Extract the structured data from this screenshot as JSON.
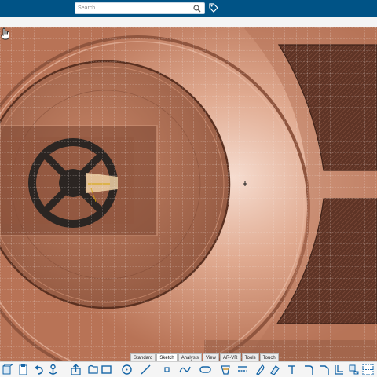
{
  "search": {
    "placeholder": "Search",
    "value": ""
  },
  "icons": {
    "search": "magnifier-icon",
    "tag": "tag-icon"
  },
  "tabs": [
    {
      "label": "Standard",
      "active": false
    },
    {
      "label": "Sketch",
      "active": true
    },
    {
      "label": "Analysis",
      "active": false
    },
    {
      "label": "View",
      "active": false
    },
    {
      "label": "AR-VR",
      "active": false
    },
    {
      "label": "Tools",
      "active": false
    },
    {
      "label": "Touch",
      "active": false
    }
  ],
  "colors": {
    "topbar": "#005386",
    "copper": "#c98c6e",
    "dark_copper": "#6b3e2c",
    "accent_blue": "#1565a6"
  },
  "toolbar_tools": [
    "view-cube-icon",
    "clipboard-icon",
    "undo-icon",
    "sketch-anchor-icon",
    "export-icon",
    "profile-icon",
    "rectangle-icon",
    "circle-icon",
    "line-icon",
    "point-icon",
    "spline-icon",
    "slot-icon",
    "axis-icon",
    "trim-icon",
    "measure-icon",
    "constraint-icon",
    "eraser-icon",
    "corner-icon",
    "chamfer-icon",
    "offset-icon",
    "projection-icon",
    "mirror-icon",
    "grid-snap-icon"
  ]
}
